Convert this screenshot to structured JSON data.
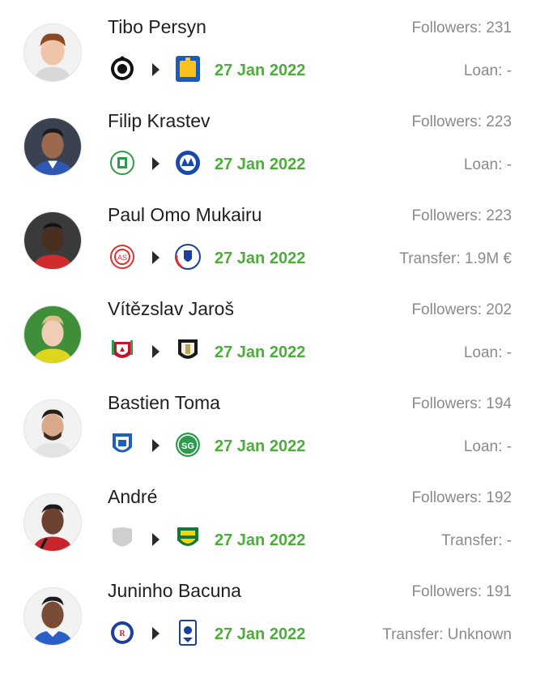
{
  "transfers": [
    {
      "name": "Tibo Persyn",
      "followers": "Followers: 231",
      "deal": "Loan: -",
      "date": "27 Jan 2022",
      "from_crest": "club-brugge-crest",
      "to_crest": "westerlo-crest",
      "avatar": "player-photo"
    },
    {
      "name": "Filip Krastev",
      "followers": "Followers: 223",
      "deal": "Loan: -",
      "date": "27 Jan 2022",
      "from_crest": "lommel-crest",
      "to_crest": "levski-sofia-crest",
      "avatar": "player-photo"
    },
    {
      "name": "Paul Omo Mukairu",
      "followers": "Followers: 223",
      "deal": "Transfer: 1.9M €",
      "date": "27 Jan 2022",
      "from_crest": "antalyaspor-crest",
      "to_crest": "fc-copenhagen-crest",
      "avatar": "player-photo"
    },
    {
      "name": "Vítězslav Jaroš",
      "followers": "Followers: 202",
      "deal": "Loan: -",
      "date": "27 Jan 2022",
      "from_crest": "liverpool-crest",
      "to_crest": "notts-county-crest",
      "avatar": "player-photo"
    },
    {
      "name": "Bastien Toma",
      "followers": "Followers: 194",
      "deal": "Loan: -",
      "date": "27 Jan 2022",
      "from_crest": "genk-crest",
      "to_crest": "st-gallen-crest",
      "avatar": "player-photo"
    },
    {
      "name": "André",
      "followers": "Followers: 192",
      "deal": "Transfer: -",
      "date": "27 Jan 2022",
      "from_crest": "placeholder-shield-crest",
      "to_crest": "cuiaba-crest",
      "avatar": "player-photo"
    },
    {
      "name": "Juninho Bacuna",
      "followers": "Followers: 191",
      "deal": "Transfer: Unknown",
      "date": "27 Jan 2022",
      "from_crest": "rangers-crest",
      "to_crest": "birmingham-city-crest",
      "avatar": "player-photo"
    }
  ]
}
